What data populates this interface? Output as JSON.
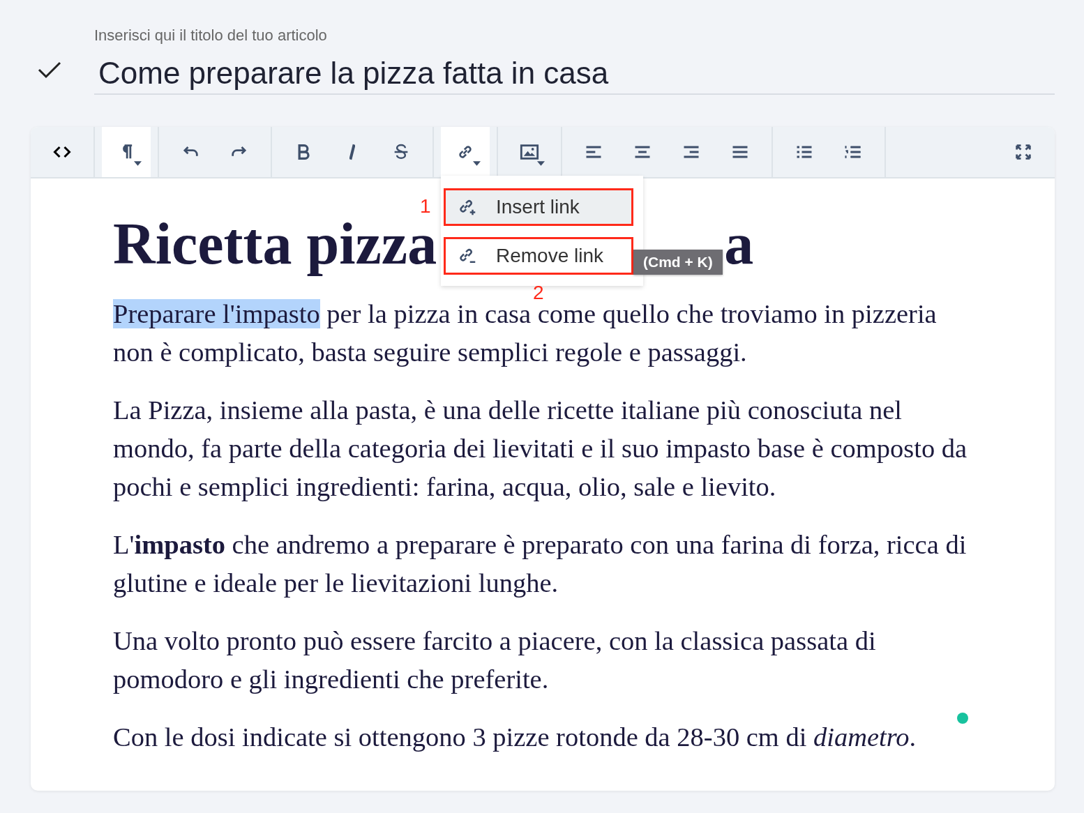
{
  "title_field": {
    "label": "Inserisci qui il titolo del tuo articolo",
    "value": "Come preparare la pizza fatta in casa",
    "saved": true
  },
  "toolbar": {
    "groups": [
      [
        {
          "kind": "code",
          "active": false,
          "dropdown": false
        }
      ],
      [
        {
          "kind": "paragraph",
          "active": true,
          "dropdown": true
        }
      ],
      [
        {
          "kind": "undo",
          "active": false,
          "dropdown": false
        },
        {
          "kind": "redo",
          "active": false,
          "dropdown": false
        }
      ],
      [
        {
          "kind": "bold",
          "active": false,
          "dropdown": false
        },
        {
          "kind": "italic",
          "active": false,
          "dropdown": false
        },
        {
          "kind": "strike",
          "active": false,
          "dropdown": false
        }
      ],
      [
        {
          "kind": "link",
          "active": true,
          "dropdown": true,
          "menu": [
            {
              "kind": "insert",
              "label": "Insert link",
              "highlighted": true,
              "callout": "1"
            },
            {
              "kind": "remove",
              "label": "Remove link",
              "highlighted": false,
              "callout": "2",
              "tooltip": "(Cmd + K)"
            }
          ]
        }
      ],
      [
        {
          "kind": "image",
          "active": false,
          "dropdown": true
        }
      ],
      [
        {
          "kind": "align-left",
          "active": false,
          "dropdown": false
        },
        {
          "kind": "align-center",
          "active": false,
          "dropdown": false
        },
        {
          "kind": "align-right",
          "active": false,
          "dropdown": false
        },
        {
          "kind": "justify",
          "active": false,
          "dropdown": false
        }
      ],
      [
        {
          "kind": "bullets",
          "active": false,
          "dropdown": false
        },
        {
          "kind": "numbers",
          "active": false,
          "dropdown": false
        }
      ]
    ],
    "end": [
      {
        "kind": "fullscreen"
      }
    ]
  },
  "document": {
    "heading_parts": [
      "Ricetta pizza",
      "a"
    ],
    "paragraphs": [
      {
        "selection": "Preparare l'impasto",
        "text": " per la pizza in casa come quello che troviamo in pizzeria non è complicato, basta seguire semplici regole e passaggi."
      },
      {
        "text": "La Pizza, insieme alla pasta, è una delle ricette italiane più conosciuta nel mondo, fa parte della categoria dei lievitati e il suo impasto base è composto da pochi e semplici ingredienti: farina, acqua, olio, sale e lievito."
      },
      {
        "text": "L'**impasto** che andremo a preparare è preparato con una farina di forza, ricca di glutine e ideale per le lievitazioni lunghe."
      },
      {
        "text": "Una volto pronto può essere farcito a piacere, con la classica passata di pomodoro e gli ingredienti che preferite."
      },
      {
        "text": "Con le dosi indicate si ottengono 3 pizze rotonde da 28-30 cm di *diametro*."
      }
    ],
    "status_dot": {
      "color": "#17c29e"
    }
  }
}
